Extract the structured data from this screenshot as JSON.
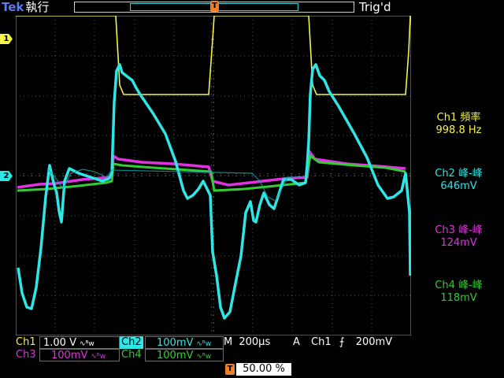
{
  "header": {
    "brand": "Tek",
    "run_state": "執行",
    "trigger_status": "Trig'd",
    "trigger_marker": "T"
  },
  "markers": {
    "ch1": "1",
    "ch2": "2",
    "trigger_position": "T"
  },
  "measurements": [
    {
      "label": "Ch1 頻率",
      "value": "998.8 Hz",
      "color": "#f3f34a"
    },
    {
      "label": "Ch2 峰-峰",
      "value": "646mV",
      "color": "#2ee6e6"
    },
    {
      "label": "Ch3 峰-峰",
      "value": "124mV",
      "color": "#e033e0"
    },
    {
      "label": "Ch4 峰-峰",
      "value": "118mV",
      "color": "#33cc33"
    }
  ],
  "channels": {
    "ch1": {
      "name": "Ch1",
      "scale": "1.00 V",
      "coupling": "∿ᴮw",
      "color": "#f3f34a"
    },
    "ch2": {
      "name": "Ch2",
      "scale": "100mV",
      "coupling": "∿ᴮw",
      "color": "#2ee6e6"
    },
    "ch3": {
      "name": "Ch3",
      "scale": "100mV",
      "coupling": "∿ᴮw",
      "color": "#e033e0"
    },
    "ch4": {
      "name": "Ch4",
      "scale": "100mV",
      "coupling": "∿ᴮw",
      "color": "#33cc33"
    }
  },
  "timebase": {
    "mode": "M",
    "value": "200µs"
  },
  "trigger": {
    "mode": "A",
    "source": "Ch1",
    "slope": "⨍",
    "level": "200mV"
  },
  "trigger_position": {
    "marker": "T",
    "value": "50.00 %"
  }
}
